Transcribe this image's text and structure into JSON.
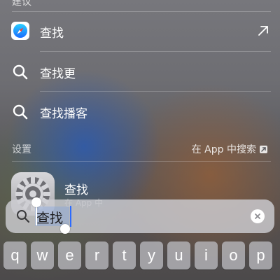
{
  "suggestions_header": "建议",
  "suggestions": [
    {
      "label": "查找",
      "icon": "safari-icon",
      "has_arrow": true
    },
    {
      "label": "查找更",
      "icon": "search-icon"
    },
    {
      "label": "查找播客",
      "icon": "search-icon"
    }
  ],
  "settings_section": {
    "title": "设置",
    "link_label": "在 App 中搜索"
  },
  "settings_result": {
    "title": "查找",
    "subtitle": "在 App 中"
  },
  "search": {
    "query": "查找",
    "icon": "search-icon",
    "clear_icon": "clear-icon"
  },
  "keyboard": {
    "row1": [
      "q",
      "w",
      "e",
      "r",
      "t",
      "y",
      "u",
      "i",
      "o",
      "p"
    ]
  },
  "colors": {
    "accent": "#2c6bff",
    "safari_blue": "#1a8cff"
  }
}
